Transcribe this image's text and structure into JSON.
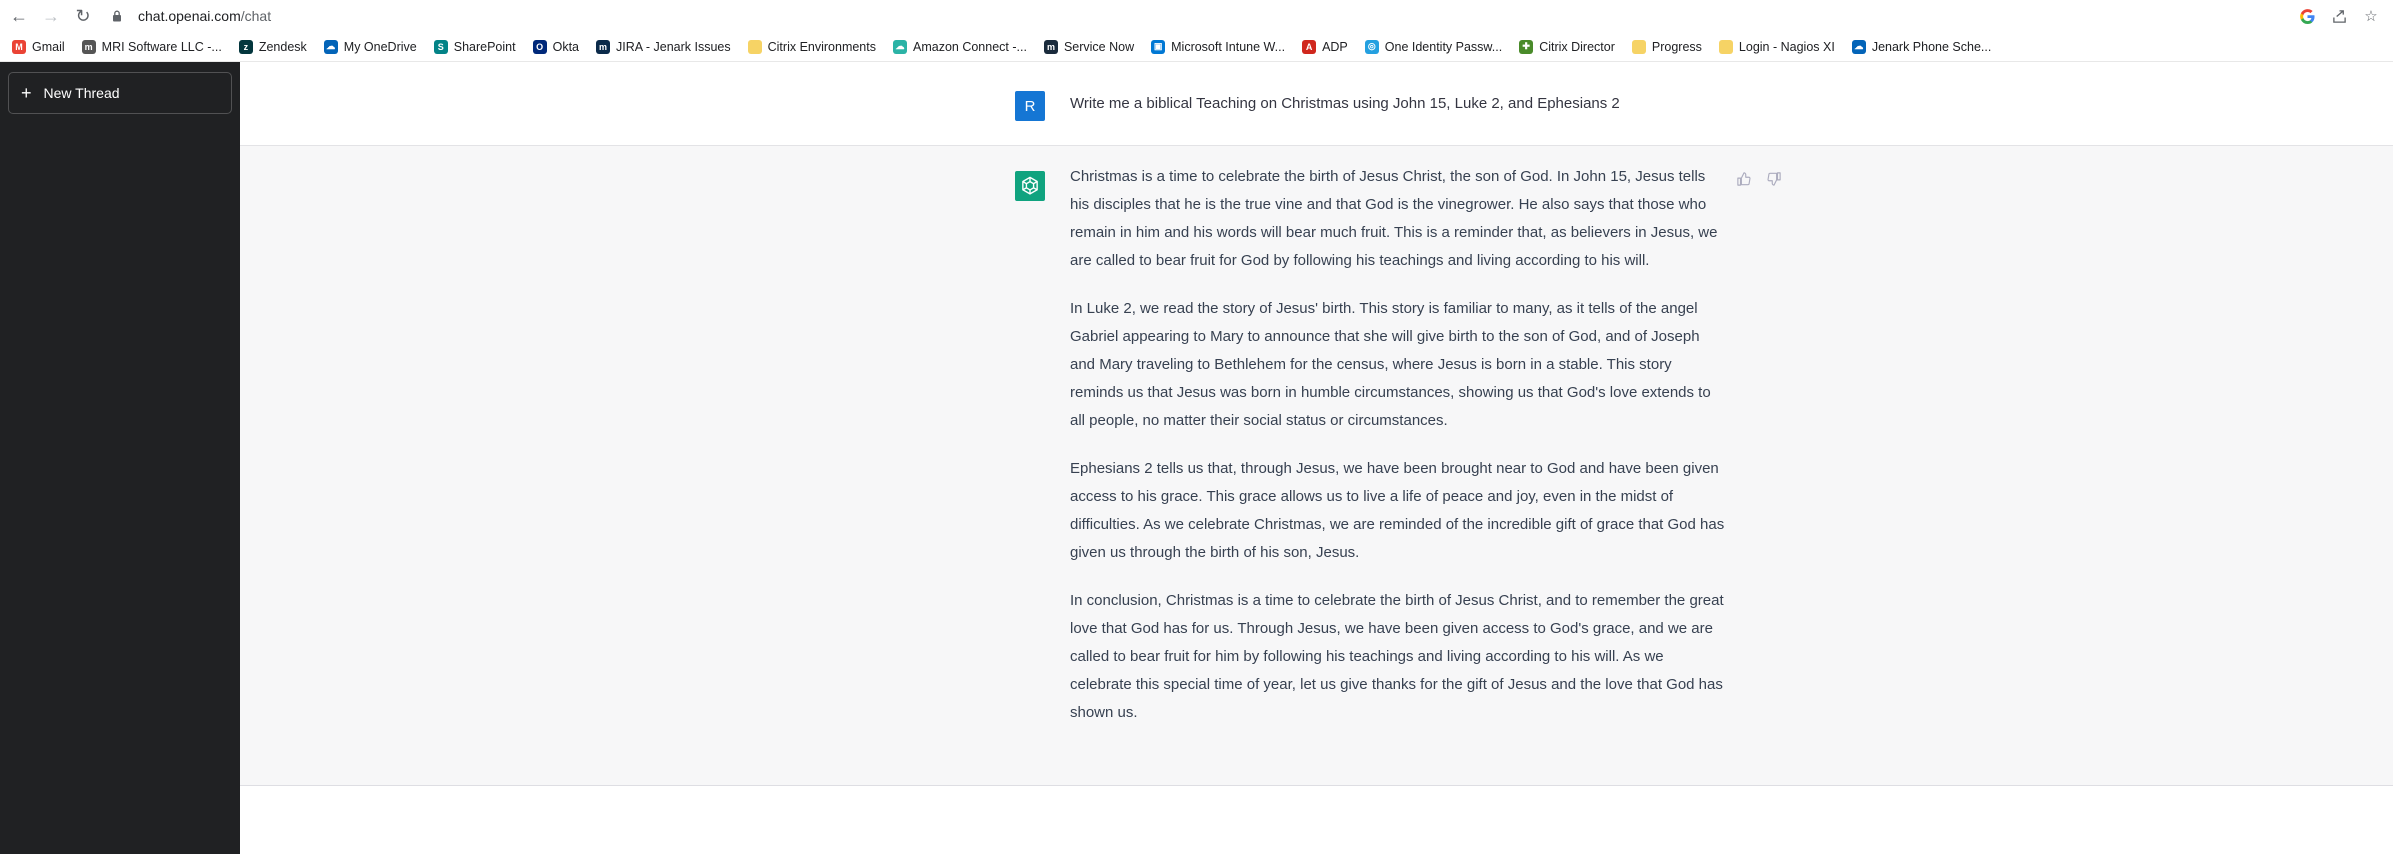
{
  "browser": {
    "url_host": "chat.openai.com",
    "url_path": "/chat"
  },
  "bookmarks": [
    {
      "label": "Gmail",
      "icon": "gmail-icon",
      "color": "#ea4335",
      "glyph": "M"
    },
    {
      "label": "MRI Software LLC -...",
      "icon": "mri-icon",
      "color": "#555555",
      "glyph": "m"
    },
    {
      "label": "Zendesk",
      "icon": "zendesk-icon",
      "color": "#03363d",
      "glyph": "z"
    },
    {
      "label": "My OneDrive",
      "icon": "onedrive-icon",
      "color": "#0364b8",
      "glyph": "☁"
    },
    {
      "label": "SharePoint",
      "icon": "sharepoint-icon",
      "color": "#038387",
      "glyph": "S"
    },
    {
      "label": "Okta",
      "icon": "okta-icon",
      "color": "#00297a",
      "glyph": "O"
    },
    {
      "label": "JIRA - Jenark Issues",
      "icon": "jira-icon",
      "color": "#0b2a4a",
      "glyph": "m"
    },
    {
      "label": "Citrix Environments",
      "icon": "folder-icon",
      "color": "#f6d365",
      "glyph": ""
    },
    {
      "label": "Amazon Connect -...",
      "icon": "amazon-connect-icon",
      "color": "#2bb3a6",
      "glyph": "☁"
    },
    {
      "label": "Service Now",
      "icon": "servicenow-icon",
      "color": "#1a2b3c",
      "glyph": "m"
    },
    {
      "label": "Microsoft Intune W...",
      "icon": "intune-icon",
      "color": "#0078d4",
      "glyph": "▣"
    },
    {
      "label": "ADP",
      "icon": "adp-icon",
      "color": "#d0271d",
      "glyph": "A"
    },
    {
      "label": "One Identity Passw...",
      "icon": "oneidentity-icon",
      "color": "#24a0e0",
      "glyph": "◎"
    },
    {
      "label": "Citrix Director",
      "icon": "citrix-director-icon",
      "color": "#4a8b2a",
      "glyph": "✚"
    },
    {
      "label": "Progress",
      "icon": "folder-icon",
      "color": "#f6d365",
      "glyph": ""
    },
    {
      "label": "Login - Nagios XI",
      "icon": "folder-icon",
      "color": "#f6d365",
      "glyph": ""
    },
    {
      "label": "Jenark Phone Sche...",
      "icon": "onedrive-icon",
      "color": "#0364b8",
      "glyph": "☁"
    }
  ],
  "sidebar": {
    "new_thread_label": "New Thread"
  },
  "conversation": {
    "user_initial": "R",
    "user_color": "#1576d4",
    "user_message": "Write me a biblical Teaching on Christmas using John 15, Luke 2, and Ephesians 2",
    "bot_color": "#10a37f",
    "bot_paragraphs": [
      "Christmas is a time to celebrate the birth of Jesus Christ, the son of God. In John 15, Jesus tells his disciples that he is the true vine and that God is the vinegrower. He also says that those who remain in him and his words will bear much fruit. This is a reminder that, as believers in Jesus, we are called to bear fruit for God by following his teachings and living according to his will.",
      "In Luke 2, we read the story of Jesus' birth. This story is familiar to many, as it tells of the angel Gabriel appearing to Mary to announce that she will give birth to the son of God, and of Joseph and Mary traveling to Bethlehem for the census, where Jesus is born in a stable. This story reminds us that Jesus was born in humble circumstances, showing us that God's love extends to all people, no matter their social status or circumstances.",
      "Ephesians 2 tells us that, through Jesus, we have been brought near to God and have been given access to his grace. This grace allows us to live a life of peace and joy, even in the midst of difficulties. As we celebrate Christmas, we are reminded of the incredible gift of grace that God has given us through the birth of his son, Jesus.",
      "In conclusion, Christmas is a time to celebrate the birth of Jesus Christ, and to remember the great love that God has for us. Through Jesus, we have been given access to God's grace, and we are called to bear fruit for him by following his teachings and living according to his will. As we celebrate this special time of year, let us give thanks for the gift of Jesus and the love that God has shown us."
    ]
  }
}
